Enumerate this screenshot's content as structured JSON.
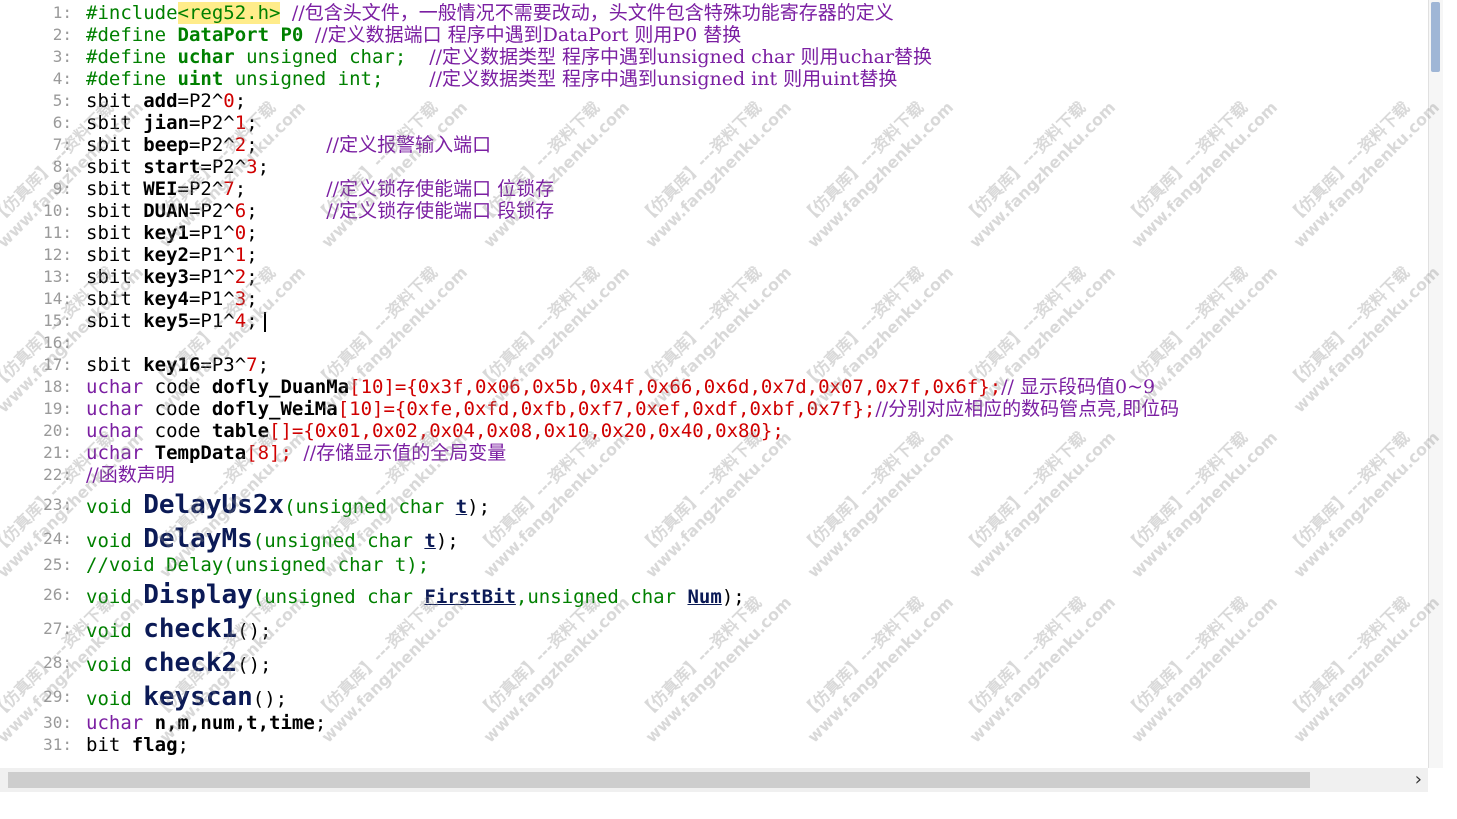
{
  "editor": {
    "lines": [
      {
        "n": "1:",
        "segs": [
          {
            "c": "pp",
            "t": "#include"
          },
          {
            "c": "inc",
            "t": "<reg52.h>"
          },
          {
            "c": "pp",
            "t": " "
          },
          {
            "c": "cm",
            "t": "//包含头文件，一般情况不需要改动，头文件包含特殊功能寄存器的定义"
          }
        ]
      },
      {
        "n": "2:",
        "segs": [
          {
            "c": "pp",
            "t": "#define "
          },
          {
            "c": "pp bold",
            "t": "DataPort P0"
          },
          {
            "c": "pp",
            "t": " "
          },
          {
            "c": "cm",
            "t": "//定义数据端口 程序中遇到DataPort 则用P0 替换"
          }
        ]
      },
      {
        "n": "3:",
        "segs": [
          {
            "c": "pp",
            "t": "#define "
          },
          {
            "c": "pp bold",
            "t": "uchar"
          },
          {
            "c": "pp",
            "t": " unsigned char;  "
          },
          {
            "c": "cm",
            "t": "//定义数据类型 程序中遇到unsigned char 则用uchar替换"
          }
        ]
      },
      {
        "n": "4:",
        "segs": [
          {
            "c": "pp",
            "t": "#define "
          },
          {
            "c": "pp bold",
            "t": "uint"
          },
          {
            "c": "pp",
            "t": " unsigned int;    "
          },
          {
            "c": "cm",
            "t": "//定义数据类型 程序中遇到unsigned int 则用uint替换"
          }
        ]
      },
      {
        "n": "5:",
        "segs": [
          {
            "c": "",
            "t": "sbit "
          },
          {
            "c": "bold",
            "t": "add"
          },
          {
            "c": "",
            "t": "=P2^"
          },
          {
            "c": "num",
            "t": "0"
          },
          {
            "c": "",
            "t": ";"
          }
        ]
      },
      {
        "n": "6:",
        "segs": [
          {
            "c": "",
            "t": "sbit "
          },
          {
            "c": "bold",
            "t": "jian"
          },
          {
            "c": "",
            "t": "=P2^"
          },
          {
            "c": "num",
            "t": "1"
          },
          {
            "c": "",
            "t": ";"
          }
        ]
      },
      {
        "n": "7:",
        "segs": [
          {
            "c": "",
            "t": "sbit "
          },
          {
            "c": "bold",
            "t": "beep"
          },
          {
            "c": "",
            "t": "=P2^"
          },
          {
            "c": "num",
            "t": "2"
          },
          {
            "c": "",
            "t": ";      "
          },
          {
            "c": "cm",
            "t": "//定义报警输入端口"
          }
        ]
      },
      {
        "n": "8:",
        "segs": [
          {
            "c": "",
            "t": "sbit "
          },
          {
            "c": "bold",
            "t": "start"
          },
          {
            "c": "",
            "t": "=P2^"
          },
          {
            "c": "num",
            "t": "3"
          },
          {
            "c": "",
            "t": ";"
          }
        ]
      },
      {
        "n": "9:",
        "segs": [
          {
            "c": "",
            "t": "sbit "
          },
          {
            "c": "bold",
            "t": "WEI"
          },
          {
            "c": "",
            "t": "=P2^"
          },
          {
            "c": "num",
            "t": "7"
          },
          {
            "c": "",
            "t": ";       "
          },
          {
            "c": "cm",
            "t": "//定义锁存使能端口 位锁存"
          }
        ]
      },
      {
        "n": "10:",
        "segs": [
          {
            "c": "",
            "t": "sbit "
          },
          {
            "c": "bold",
            "t": "DUAN"
          },
          {
            "c": "",
            "t": "=P2^"
          },
          {
            "c": "num",
            "t": "6"
          },
          {
            "c": "",
            "t": ";      "
          },
          {
            "c": "cm",
            "t": "//定义锁存使能端口 段锁存"
          }
        ]
      },
      {
        "n": "11:",
        "segs": [
          {
            "c": "",
            "t": "sbit "
          },
          {
            "c": "bold",
            "t": "key1"
          },
          {
            "c": "",
            "t": "=P1^"
          },
          {
            "c": "num",
            "t": "0"
          },
          {
            "c": "",
            "t": ";"
          }
        ]
      },
      {
        "n": "12:",
        "segs": [
          {
            "c": "",
            "t": "sbit "
          },
          {
            "c": "bold",
            "t": "key2"
          },
          {
            "c": "",
            "t": "=P1^"
          },
          {
            "c": "num",
            "t": "1"
          },
          {
            "c": "",
            "t": ";"
          }
        ]
      },
      {
        "n": "13:",
        "segs": [
          {
            "c": "",
            "t": "sbit "
          },
          {
            "c": "bold",
            "t": "key3"
          },
          {
            "c": "",
            "t": "=P1^"
          },
          {
            "c": "num",
            "t": "2"
          },
          {
            "c": "",
            "t": ";"
          }
        ]
      },
      {
        "n": "14:",
        "segs": [
          {
            "c": "",
            "t": "sbit "
          },
          {
            "c": "bold",
            "t": "key4"
          },
          {
            "c": "",
            "t": "=P1^"
          },
          {
            "c": "num",
            "t": "3"
          },
          {
            "c": "",
            "t": ";"
          }
        ]
      },
      {
        "n": "15:",
        "segs": [
          {
            "c": "",
            "t": "sbit "
          },
          {
            "c": "bold",
            "t": "key5"
          },
          {
            "c": "",
            "t": "=P1^"
          },
          {
            "c": "num",
            "t": "4"
          },
          {
            "c": "",
            "t": ";"
          }
        ],
        "cursor": true
      },
      {
        "n": "16:",
        "segs": []
      },
      {
        "n": "17:",
        "segs": [
          {
            "c": "",
            "t": "sbit "
          },
          {
            "c": "bold",
            "t": "key16"
          },
          {
            "c": "",
            "t": "=P3^"
          },
          {
            "c": "num",
            "t": "7"
          },
          {
            "c": "",
            "t": ";"
          }
        ]
      },
      {
        "n": "18:",
        "segs": [
          {
            "c": "kw",
            "t": "uchar"
          },
          {
            "c": "",
            "t": " code "
          },
          {
            "c": "bold",
            "t": "dofly_DuanMa"
          },
          {
            "c": "num",
            "t": "[10]={0x3f,0x06,0x5b,0x4f,0x66,0x6d,0x7d,0x07,0x7f,0x6f};"
          },
          {
            "c": "cm",
            "t": "// 显示段码值0~9"
          }
        ]
      },
      {
        "n": "19:",
        "segs": [
          {
            "c": "kw",
            "t": "uchar"
          },
          {
            "c": "",
            "t": " code "
          },
          {
            "c": "bold",
            "t": "dofly_WeiMa"
          },
          {
            "c": "num",
            "t": "[10]={0xfe,0xfd,0xfb,0xf7,0xef,0xdf,0xbf,0x7f};"
          },
          {
            "c": "cm",
            "t": "//分别对应相应的数码管点亮,即位码"
          }
        ]
      },
      {
        "n": "20:",
        "segs": [
          {
            "c": "kw",
            "t": "uchar"
          },
          {
            "c": "",
            "t": " code "
          },
          {
            "c": "bold",
            "t": "table"
          },
          {
            "c": "num",
            "t": "[]={0x01,0x02,0x04,0x08,0x10,0x20,0x40,0x80};"
          }
        ]
      },
      {
        "n": "21:",
        "segs": [
          {
            "c": "kw",
            "t": "uchar"
          },
          {
            "c": "",
            "t": " "
          },
          {
            "c": "bold",
            "t": "TempData"
          },
          {
            "c": "num",
            "t": "[8];"
          },
          {
            "c": "",
            "t": " "
          },
          {
            "c": "cm",
            "t": "//存储显示值的全局变量"
          }
        ]
      },
      {
        "n": "22:",
        "segs": [
          {
            "c": "cm",
            "t": "//函数声明"
          }
        ]
      },
      {
        "n": "23:",
        "segs": [
          {
            "c": "pp",
            "t": "void "
          },
          {
            "c": "fn",
            "t": "DelayUs2x"
          },
          {
            "c": "pp",
            "t": "(unsigned char "
          },
          {
            "c": "par",
            "t": "t"
          },
          {
            "c": "",
            "t": ");"
          }
        ]
      },
      {
        "n": "24:",
        "segs": [
          {
            "c": "pp",
            "t": "void "
          },
          {
            "c": "fn",
            "t": "DelayMs"
          },
          {
            "c": "pp",
            "t": "(unsigned char "
          },
          {
            "c": "par",
            "t": "t"
          },
          {
            "c": "",
            "t": ");"
          }
        ]
      },
      {
        "n": "25:",
        "segs": [
          {
            "c": "pp",
            "t": "//void Delay(unsigned char t);"
          }
        ]
      },
      {
        "n": "26:",
        "segs": [
          {
            "c": "pp",
            "t": "void "
          },
          {
            "c": "fn",
            "t": "Display"
          },
          {
            "c": "pp",
            "t": "(unsigned char "
          },
          {
            "c": "par",
            "t": "FirstBit"
          },
          {
            "c": "pp",
            "t": ",unsigned char "
          },
          {
            "c": "par",
            "t": "Num"
          },
          {
            "c": "",
            "t": ");"
          }
        ]
      },
      {
        "n": "27:",
        "segs": [
          {
            "c": "pp",
            "t": "void "
          },
          {
            "c": "fn",
            "t": "check1"
          },
          {
            "c": "",
            "t": "();"
          }
        ]
      },
      {
        "n": "28:",
        "segs": [
          {
            "c": "pp",
            "t": "void "
          },
          {
            "c": "fn",
            "t": "check2"
          },
          {
            "c": "",
            "t": "();"
          }
        ]
      },
      {
        "n": "29:",
        "segs": [
          {
            "c": "pp",
            "t": "void "
          },
          {
            "c": "fn",
            "t": "keyscan"
          },
          {
            "c": "",
            "t": "();"
          }
        ]
      },
      {
        "n": "30:",
        "segs": [
          {
            "c": "kw",
            "t": "uchar"
          },
          {
            "c": "",
            "t": " "
          },
          {
            "c": "bold",
            "t": "n,m,num,t,time"
          },
          {
            "c": "",
            "t": ";"
          }
        ]
      },
      {
        "n": "31:",
        "segs": [
          {
            "c": "",
            "t": "bit "
          },
          {
            "c": "bold",
            "t": "flag"
          },
          {
            "c": "",
            "t": ";"
          }
        ]
      }
    ]
  },
  "watermark": {
    "line1": "【仿真库】---资料下载",
    "line2": "www.fangzhenku.com"
  },
  "scrollbar": {
    "right_arrow": "›"
  }
}
